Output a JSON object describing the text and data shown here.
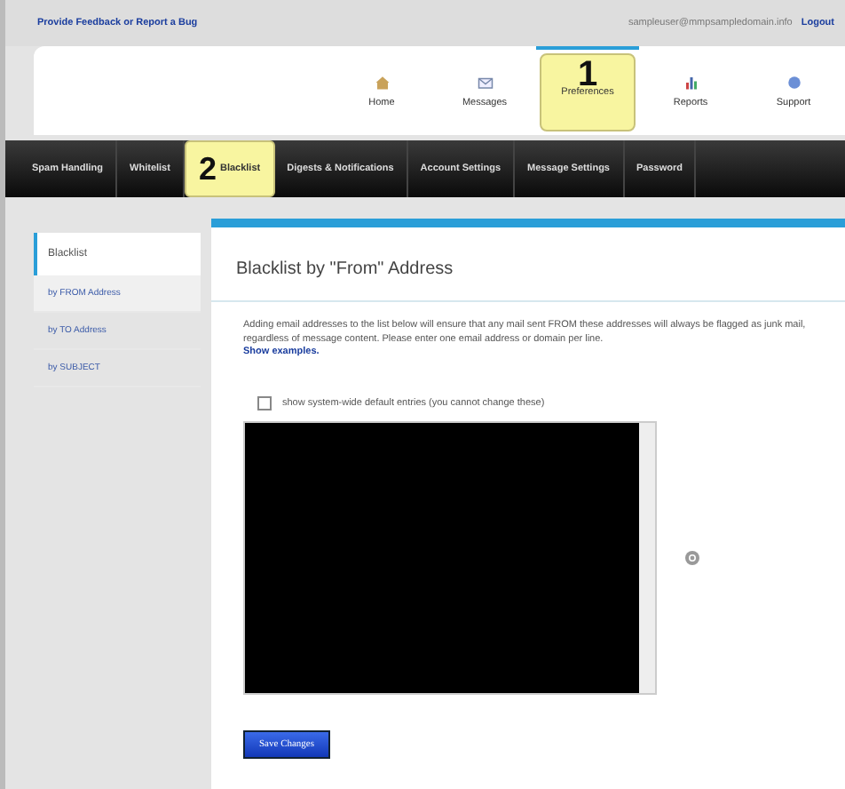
{
  "top_bar": {
    "feedback_link": "Provide Feedback or Report a Bug",
    "user_email": "sampleuser@mmpsampledomain.info",
    "logout_link": "Logout"
  },
  "main_nav": [
    {
      "label": "Home",
      "selected": false
    },
    {
      "label": "Messages",
      "selected": false
    },
    {
      "label": "Preferences",
      "selected": true,
      "callout": "1"
    },
    {
      "label": "Reports",
      "selected": false
    },
    {
      "label": "Support",
      "selected": false
    }
  ],
  "sub_nav": [
    {
      "label": "Spam Handling",
      "selected": false
    },
    {
      "label": "Whitelist",
      "selected": false
    },
    {
      "label": "Blacklist",
      "selected": true,
      "callout": "2"
    },
    {
      "label": "Digests & Notifications",
      "selected": false
    },
    {
      "label": "Account Settings",
      "selected": false
    },
    {
      "label": "Message Settings",
      "selected": false
    },
    {
      "label": "Password",
      "selected": false
    }
  ],
  "sidebar": {
    "heading": "Blacklist",
    "items": [
      {
        "label": "by FROM Address",
        "selected": true
      },
      {
        "label": "by TO Address",
        "selected": false
      },
      {
        "label": "by SUBJECT",
        "selected": false
      }
    ]
  },
  "panel": {
    "title": "Blacklist by \"From\" Address",
    "description": "Adding email addresses to the list below will ensure that any mail sent FROM these addresses will always be flagged as junk mail, regardless of message content. Please enter one email address or domain per line.",
    "examples_link": "Show examples.",
    "checkbox": {
      "label": "show system-wide default entries (you cannot change these)",
      "checked": false
    },
    "save_button": "Save Changes"
  }
}
